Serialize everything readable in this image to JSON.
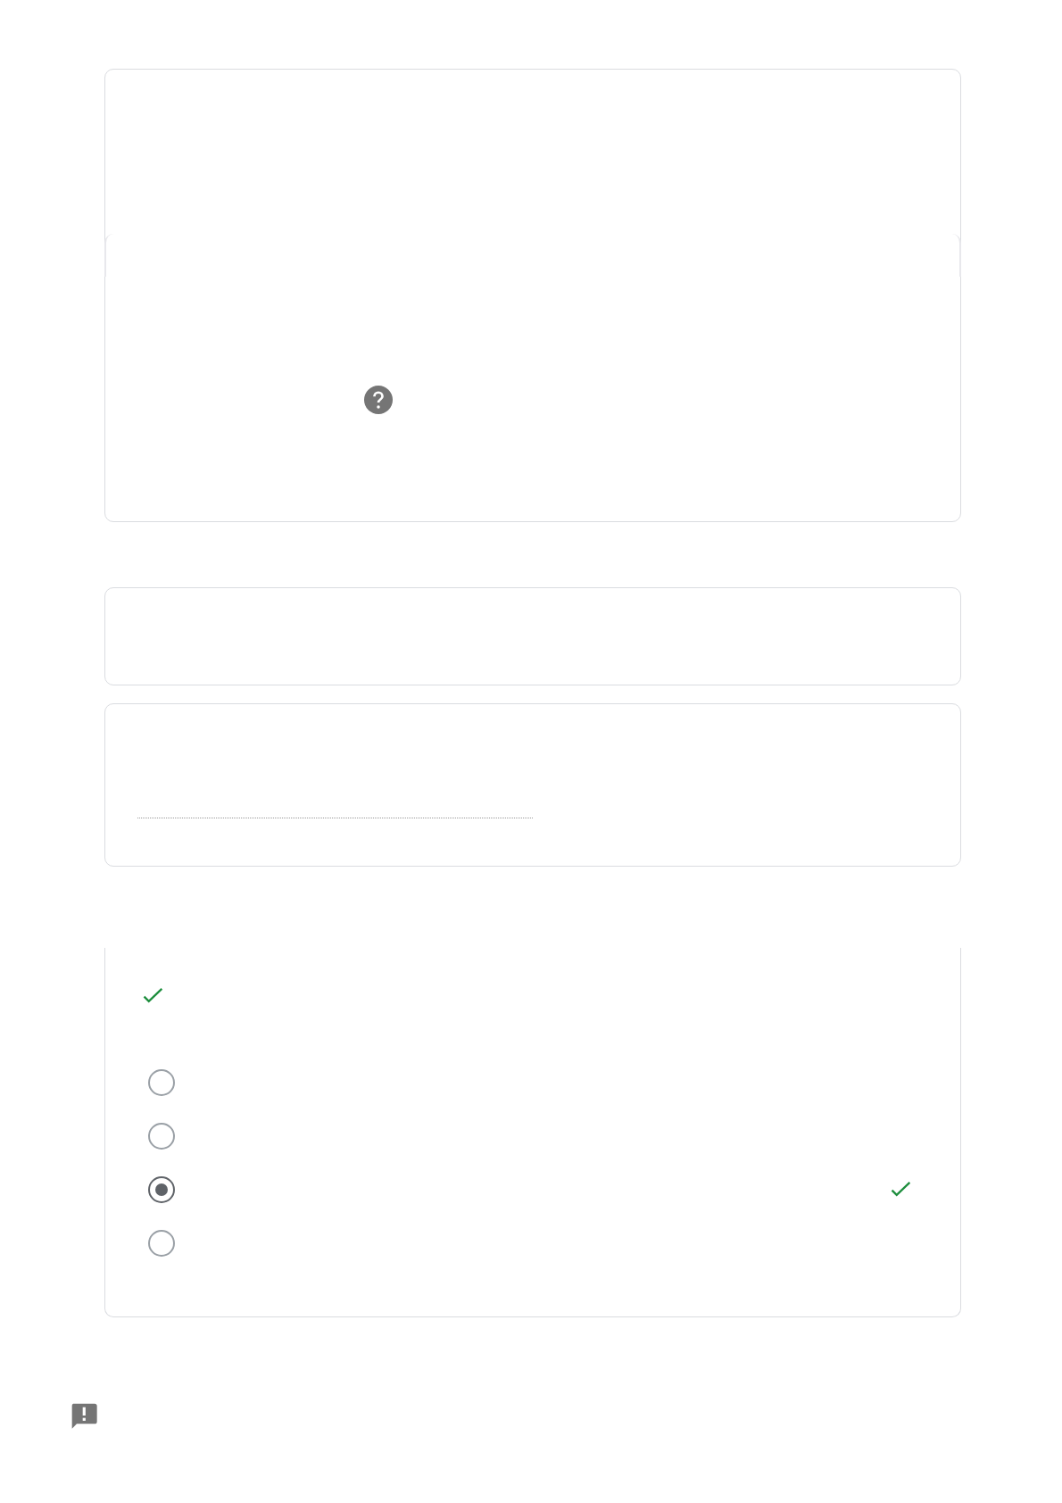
{
  "cards": [
    {
      "kind": "help"
    },
    {
      "kind": "blank"
    },
    {
      "kind": "text"
    },
    {
      "kind": "choice",
      "correct": true,
      "options": [
        {
          "selected": false,
          "correct": false
        },
        {
          "selected": false,
          "correct": false
        },
        {
          "selected": true,
          "correct": true
        },
        {
          "selected": false,
          "correct": false
        }
      ]
    }
  ],
  "feedback": {
    "shown": true
  }
}
